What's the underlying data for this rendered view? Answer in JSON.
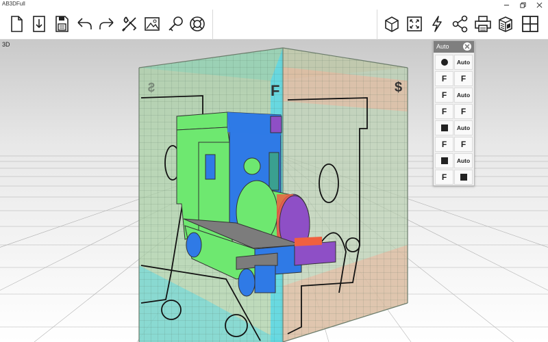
{
  "window": {
    "title": "AB3DFull"
  },
  "view": {
    "label": "3D"
  },
  "panel": {
    "title": "Auto",
    "rows": [
      {
        "left": "dot",
        "right": "Auto"
      },
      {
        "left": "F",
        "right": "F"
      },
      {
        "left": "F",
        "right": "Auto"
      },
      {
        "left": "F",
        "right": "F"
      },
      {
        "left": "square",
        "right": "Auto"
      },
      {
        "left": "F",
        "right": "F"
      },
      {
        "left": "square",
        "right": "Auto"
      },
      {
        "left": "F",
        "right": "square"
      }
    ]
  },
  "toolbar": {
    "left_icons": [
      "new-file-icon",
      "import-icon",
      "save-icon",
      "undo-icon",
      "redo-icon",
      "tools-icon",
      "image-icon",
      "key-icon",
      "help-lifebuoy-icon"
    ],
    "right_icons": [
      "cube-view-icon",
      "fit-view-icon",
      "lightning-icon",
      "share-icon",
      "print-icon",
      "package-icon",
      "layout-grid-icon"
    ]
  },
  "colors": {
    "cyan_face": "#5fd8e4",
    "salmon_face": "#f0b49c",
    "green_face": "#a9cfa6",
    "model_green": "#6ee870",
    "model_blue": "#2f7ae6",
    "model_purple": "#8e4fc6",
    "model_orange": "#f06040",
    "model_gray": "#7c7c7c"
  }
}
